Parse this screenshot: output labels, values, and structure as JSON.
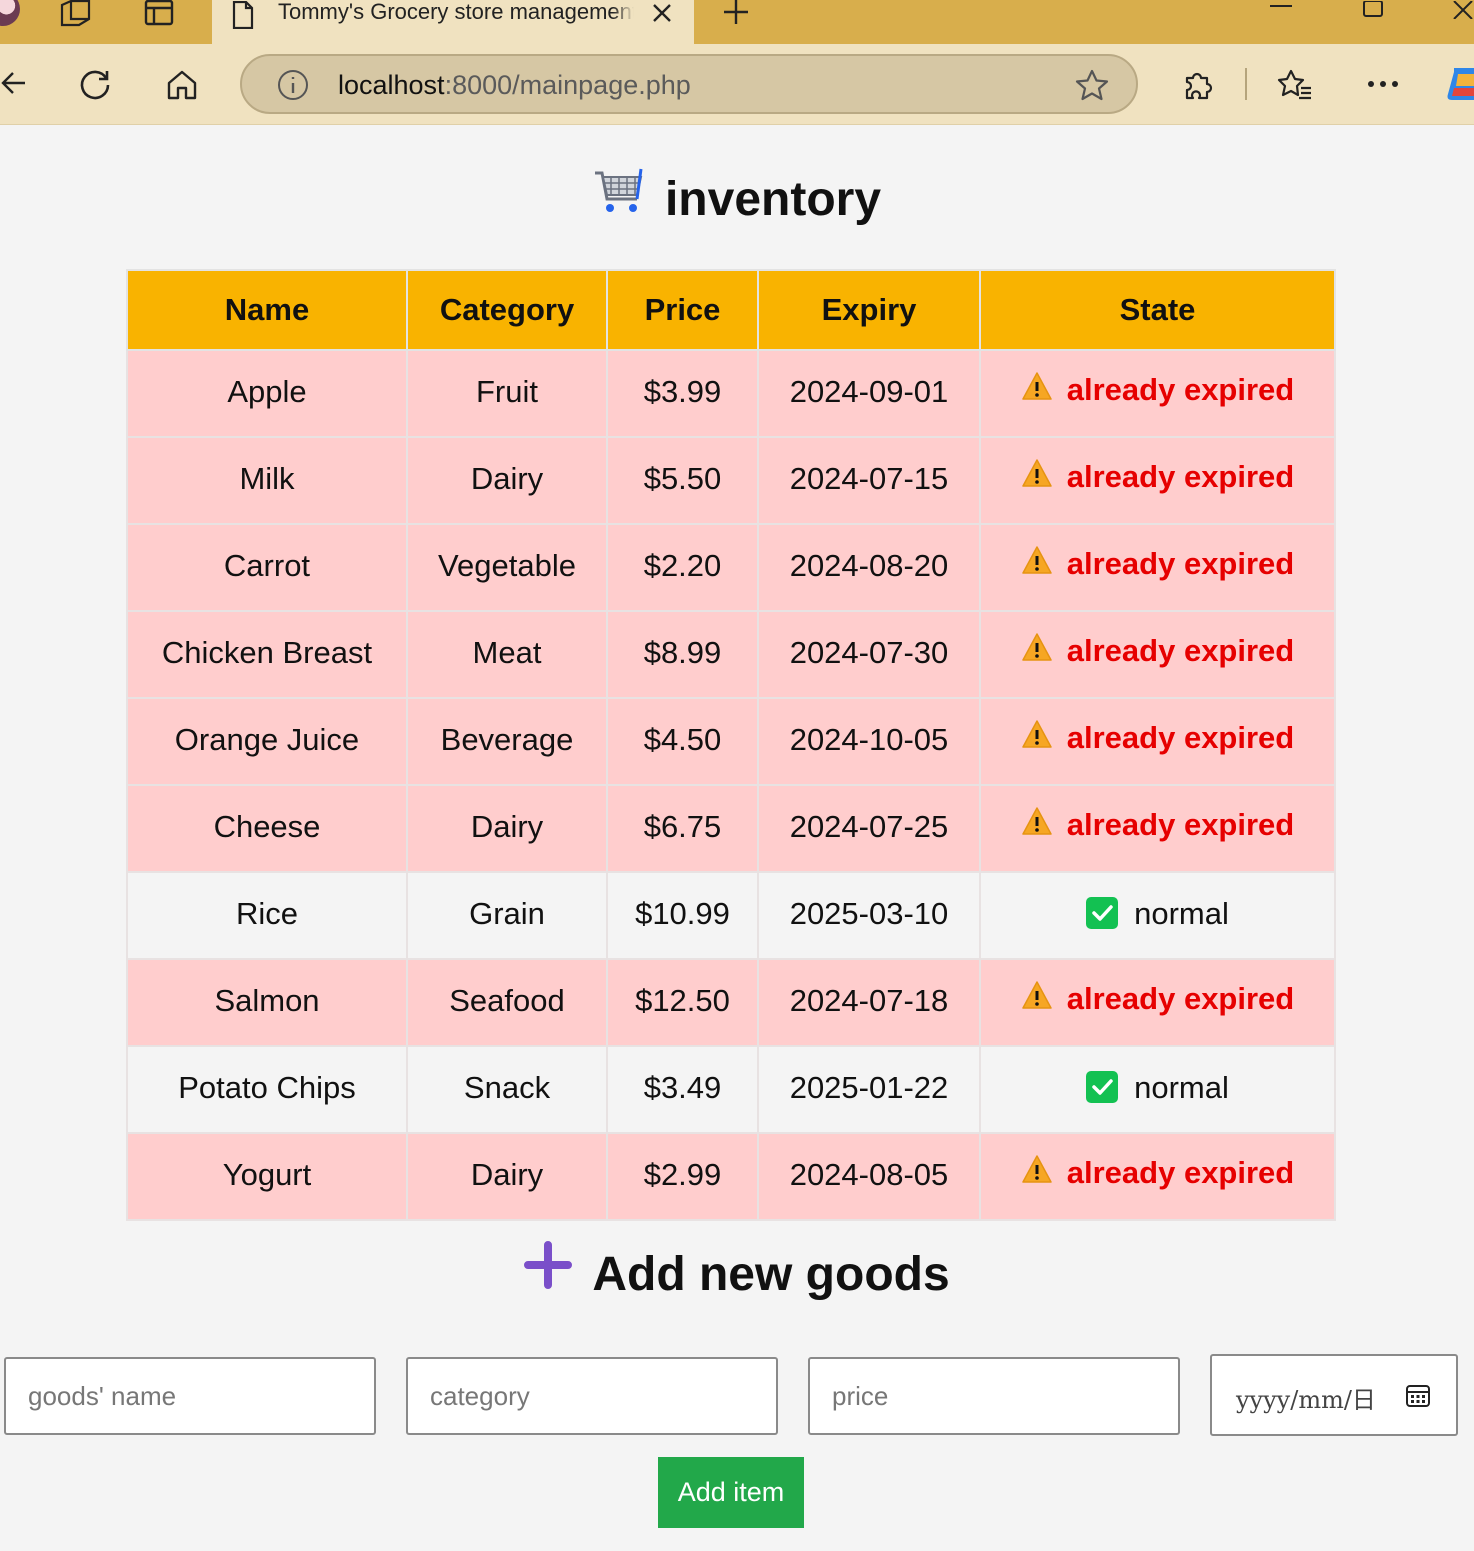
{
  "browser": {
    "tab_title": "Tommy's Grocery store management",
    "url_host": "localhost",
    "url_path": ":8000/mainpage.php"
  },
  "page": {
    "title": "inventory",
    "add_title": "Add new goods"
  },
  "table": {
    "headers": [
      "Name",
      "Category",
      "Price",
      "Expiry",
      "State"
    ],
    "rows": [
      {
        "name": "Apple",
        "category": "Fruit",
        "price": "$3.99",
        "expiry": "2024-09-01",
        "state": "already expired",
        "expired": true
      },
      {
        "name": "Milk",
        "category": "Dairy",
        "price": "$5.50",
        "expiry": "2024-07-15",
        "state": "already expired",
        "expired": true
      },
      {
        "name": "Carrot",
        "category": "Vegetable",
        "price": "$2.20",
        "expiry": "2024-08-20",
        "state": "already expired",
        "expired": true
      },
      {
        "name": "Chicken Breast",
        "category": "Meat",
        "price": "$8.99",
        "expiry": "2024-07-30",
        "state": "already expired",
        "expired": true
      },
      {
        "name": "Orange Juice",
        "category": "Beverage",
        "price": "$4.50",
        "expiry": "2024-10-05",
        "state": "already expired",
        "expired": true
      },
      {
        "name": "Cheese",
        "category": "Dairy",
        "price": "$6.75",
        "expiry": "2024-07-25",
        "state": "already expired",
        "expired": true
      },
      {
        "name": "Rice",
        "category": "Grain",
        "price": "$10.99",
        "expiry": "2025-03-10",
        "state": "normal",
        "expired": false
      },
      {
        "name": "Salmon",
        "category": "Seafood",
        "price": "$12.50",
        "expiry": "2024-07-18",
        "state": "already expired",
        "expired": true
      },
      {
        "name": "Potato Chips",
        "category": "Snack",
        "price": "$3.49",
        "expiry": "2025-01-22",
        "state": "normal",
        "expired": false
      },
      {
        "name": "Yogurt",
        "category": "Dairy",
        "price": "$2.99",
        "expiry": "2024-08-05",
        "state": "already expired",
        "expired": true
      }
    ]
  },
  "form": {
    "name_placeholder": "goods' name",
    "category_placeholder": "category",
    "price_placeholder": "price",
    "date_placeholder": "yyyy/mm/日",
    "submit_label": "Add item"
  },
  "colors": {
    "header_bg": "#f9b300",
    "expired_row_bg": "#ffcdcd",
    "expired_text": "#e60000",
    "submit_bg": "#22a84a",
    "tab_strip": "#d8ae4c"
  },
  "icons": {
    "title": "shopping-cart-icon",
    "add_title": "plus-icon",
    "expired_state": "warning-icon",
    "normal_state": "check-icon"
  }
}
